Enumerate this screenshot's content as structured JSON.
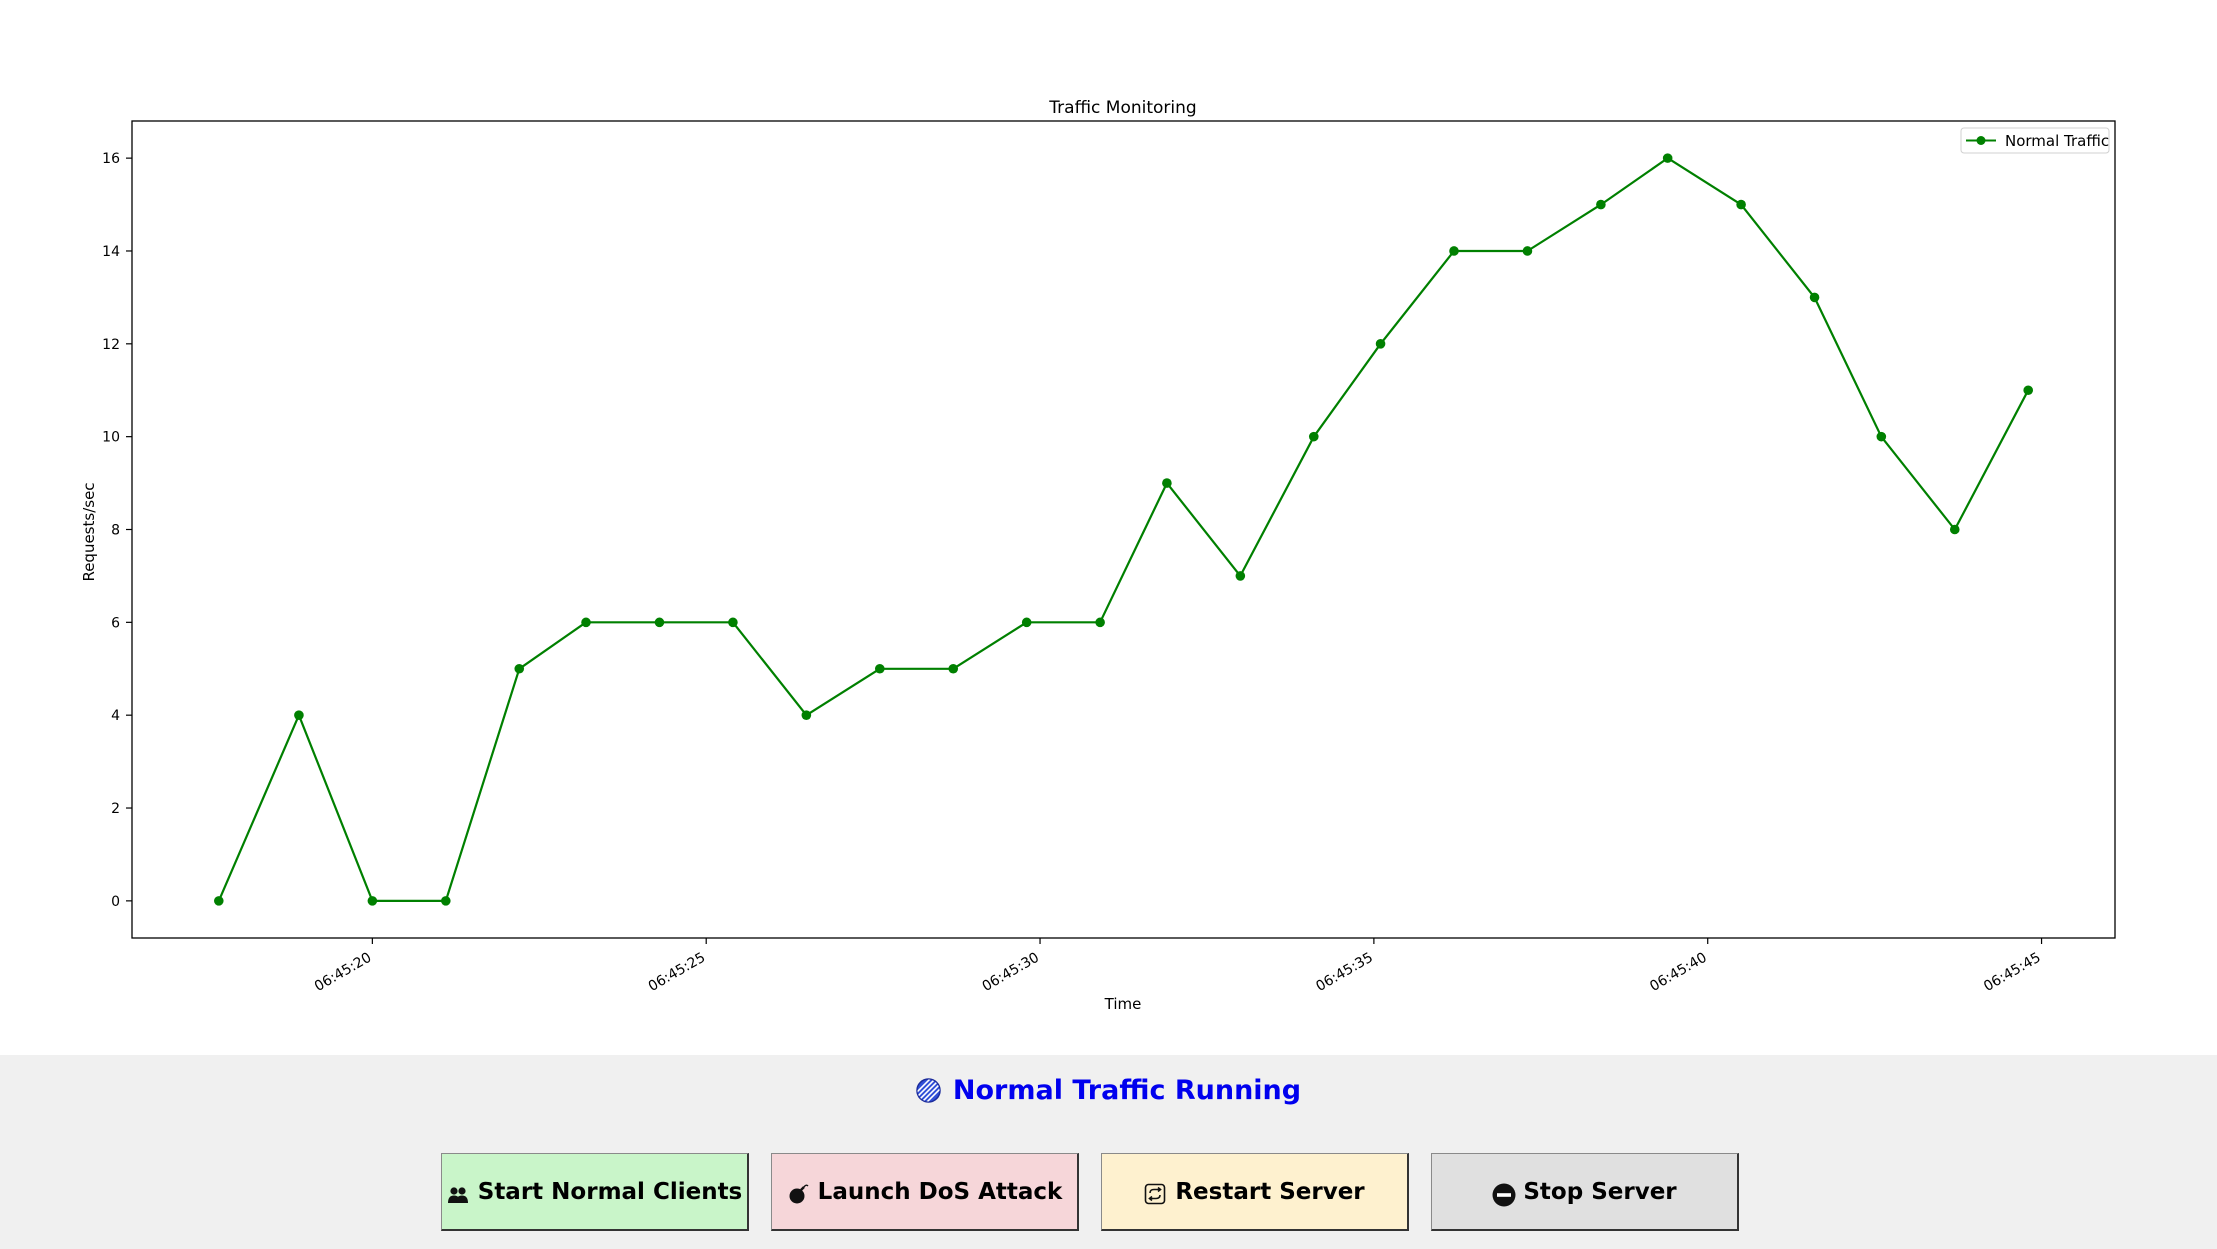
{
  "chart_data": {
    "type": "line",
    "title": "Traffic Monitoring",
    "xlabel": "Time",
    "ylabel": "Requests/sec",
    "x": [
      "06:45:17.7",
      "06:45:18.9",
      "06:45:20.0",
      "06:45:21.1",
      "06:45:22.2",
      "06:45:23.2",
      "06:45:24.3",
      "06:45:25.4",
      "06:45:26.5",
      "06:45:27.6",
      "06:45:28.7",
      "06:45:29.8",
      "06:45:30.9",
      "06:45:31.9",
      "06:45:33.0",
      "06:45:34.1",
      "06:45:35.1",
      "06:45:36.2",
      "06:45:37.3",
      "06:45:38.4",
      "06:45:39.4",
      "06:45:40.5",
      "06:45:41.6",
      "06:45:42.6",
      "06:45:43.7",
      "06:45:44.8"
    ],
    "series": [
      {
        "name": "Normal Traffic",
        "color": "#008000",
        "values": [
          0,
          4,
          0,
          0,
          5,
          6,
          6,
          6,
          4,
          5,
          5,
          6,
          6,
          9,
          7,
          10,
          12,
          14,
          14,
          15,
          16,
          15,
          13,
          10,
          8,
          11
        ]
      }
    ],
    "xticks": [
      "06:45:20",
      "06:45:25",
      "06:45:30",
      "06:45:35",
      "06:45:40",
      "06:45:45"
    ],
    "yticks": [
      0,
      2,
      4,
      6,
      8,
      10,
      12,
      14,
      16
    ],
    "xlim": [
      "06:45:16.4",
      "06:45:46.1"
    ],
    "ylim": [
      -0.8,
      16.8
    ],
    "legend": "upper right",
    "grid": false
  },
  "status": {
    "text": "Normal Traffic Running",
    "color": "#0000ee",
    "icon": "striped-circle-icon"
  },
  "buttons": [
    {
      "label": "Start Normal Clients",
      "icon": "people-icon",
      "bg": "#c9f5c9"
    },
    {
      "label": "Launch DoS Attack",
      "icon": "bomb-icon",
      "bg": "#f6d6d9"
    },
    {
      "label": "Restart Server",
      "icon": "repeat-icon",
      "bg": "#fef1cf"
    },
    {
      "label": "Stop Server",
      "icon": "no-entry-icon",
      "bg": "#e0e0e0"
    }
  ]
}
